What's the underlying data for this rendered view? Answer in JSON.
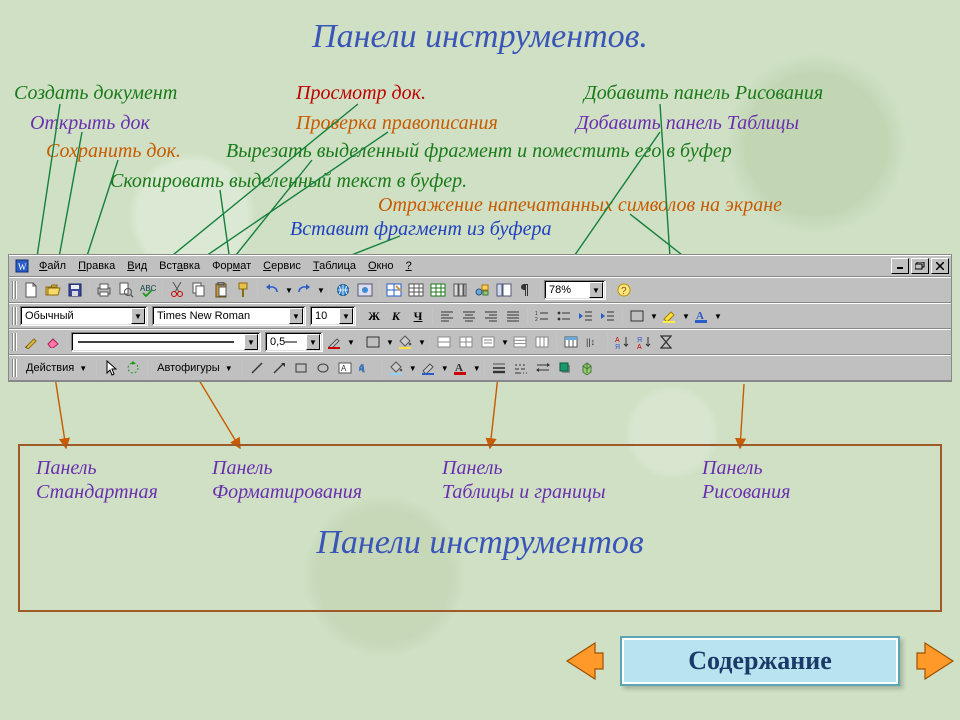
{
  "title": "Панели инструментов.",
  "annotations": {
    "a1": "Создать документ",
    "a2": "Открыть док",
    "a3": "Сохранить док.",
    "a4": "Скопировать выделенный текст в буфер.",
    "a5": "Просмотр док.",
    "a6": "Проверка правописания",
    "a7": "Вырезать выделенный фрагмент и поместить его в буфер",
    "a8": "Добавить панель Рисования",
    "a9": "Добавить панель Таблицы",
    "a10": "Отражение напечатанных символов на экране",
    "a11": "Вставит фрагмент из буфера"
  },
  "menu": {
    "file": {
      "pre": "",
      "u": "Ф",
      "post": "айл"
    },
    "edit": {
      "pre": "",
      "u": "П",
      "post": "равка"
    },
    "view": {
      "pre": "",
      "u": "В",
      "post": "ид"
    },
    "insert": {
      "pre": "Вст",
      "u": "а",
      "post": "вка"
    },
    "format": {
      "pre": "Фор",
      "u": "м",
      "post": "ат"
    },
    "tools": {
      "pre": "",
      "u": "С",
      "post": "ервис"
    },
    "table": {
      "pre": "",
      "u": "Т",
      "post": "аблица"
    },
    "window": {
      "pre": "",
      "u": "О",
      "post": "кно"
    },
    "help": {
      "pre": "",
      "u": "?",
      "post": ""
    }
  },
  "standard": {
    "zoom": "78%"
  },
  "formatting": {
    "style": "Обычный",
    "font": "Times New Roman",
    "size": "10",
    "bold": "Ж",
    "italic": "К",
    "underline": "Ч"
  },
  "tables": {
    "weight": "0,5"
  },
  "drawing": {
    "actions": "Действия",
    "autoshapes": "Автофигуры"
  },
  "legend": {
    "c1a": "Панель",
    "c1b": "Стандартная",
    "c2a": "Панель",
    "c2b": "Форматирования",
    "c3a": "Панель",
    "c3b": "Таблицы и границы",
    "c4a": "Панель",
    "c4b": "Рисования",
    "big": "Панели инструментов"
  },
  "nav": {
    "label": "Содержание"
  },
  "icons": {
    "new": "new-doc-icon",
    "open": "open-icon",
    "save": "save-icon",
    "print": "print-icon",
    "preview": "preview-icon",
    "spell": "spell-icon",
    "cut": "cut-icon",
    "copy": "copy-icon",
    "paste": "paste-icon",
    "fmtpaint": "format-painter-icon",
    "undo": "undo-icon",
    "redo": "redo-icon",
    "link": "hyperlink-icon",
    "webtb": "web-toolbar-icon",
    "tablesb": "tables-borders-icon",
    "instbl": "insert-table-icon",
    "xls": "excel-icon",
    "cols": "columns-icon",
    "drawtb": "drawing-toolbar-icon",
    "map": "doc-map-icon",
    "para": "show-para-icon",
    "alignL": "align-left-icon",
    "alignC": "align-center-icon",
    "alignR": "align-right-icon",
    "alignJ": "justify-icon",
    "numlist": "numbered-list-icon",
    "bullist": "bullet-list-icon",
    "outdent": "outdent-icon",
    "indent": "indent-icon",
    "border": "outside-border-icon",
    "hl": "highlight-icon",
    "fontcol": "font-color-icon",
    "drawtable": "draw-table-icon",
    "eraser": "eraser-icon",
    "linestyle": "line-style-icon",
    "bcolor": "border-color-icon",
    "shading": "shading-color-icon",
    "mergec": "merge-cells-icon",
    "splitc": "split-cells-icon",
    "aligncell": "cell-align-icon",
    "distr": "distribute-rows-icon",
    "distc": "distribute-cols-icon",
    "autofmt": "table-autoformat-icon",
    "sortA": "sort-asc-icon",
    "sortD": "sort-desc-icon",
    "sum": "autosum-icon",
    "select": "select-icon",
    "rotate": "rotate-icon",
    "line": "line-icon",
    "arrow": "arrow-icon",
    "rect": "rectangle-icon",
    "oval": "oval-icon",
    "textbox": "textbox-icon",
    "wordart": "wordart-icon",
    "fill": "fill-color-icon",
    "linecol": "line-color-icon",
    "fontcol2": "font-color-icon",
    "linesty": "line-style-icon",
    "dash": "dash-style-icon",
    "arrowsty": "arrow-style-icon",
    "shadow": "shadow-icon",
    "threeD": "3d-icon",
    "applogo": "app-logo-icon",
    "min": "minimize-icon",
    "restore": "restore-icon",
    "close": "close-icon",
    "help": "help-icon"
  }
}
